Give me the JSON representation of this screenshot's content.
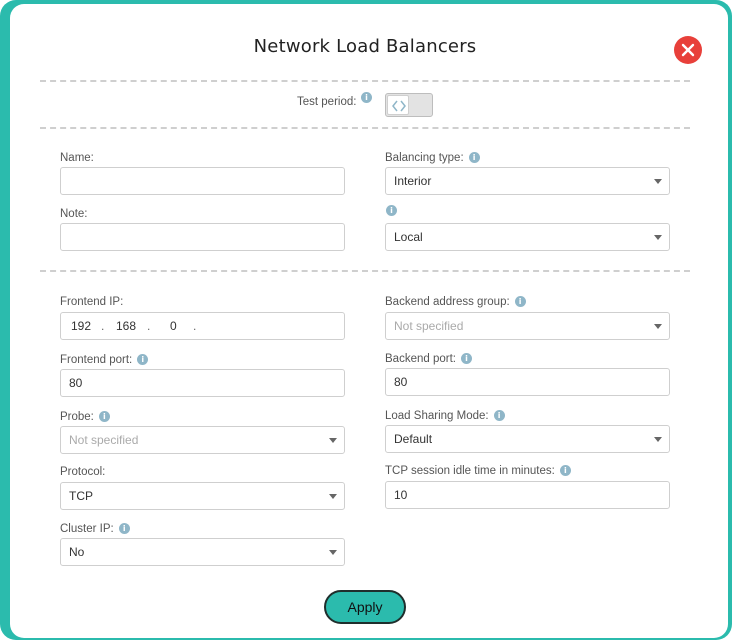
{
  "dialog": {
    "title": "Network Load Balancers",
    "test_period_label": "Test period:",
    "test_period_enabled": false
  },
  "form": {
    "name": {
      "label": "Name:",
      "value": ""
    },
    "note": {
      "label": "Note:",
      "value": ""
    },
    "balancing_type": {
      "label": "Balancing type:",
      "value": "Interior"
    },
    "scope": {
      "value": "Local"
    },
    "frontend_ip": {
      "label": "Frontend IP:",
      "octets": [
        "192",
        "168",
        "0",
        ""
      ],
      "dot": "."
    },
    "frontend_port": {
      "label": "Frontend port:",
      "value": "80"
    },
    "probe": {
      "label": "Probe:",
      "value": "Not specified"
    },
    "protocol": {
      "label": "Protocol:",
      "value": "TCP"
    },
    "cluster_ip": {
      "label": "Cluster IP:",
      "value": "No"
    },
    "backend_address_group": {
      "label": "Backend address group:",
      "value": "Not specified"
    },
    "backend_port": {
      "label": "Backend port:",
      "value": "80"
    },
    "load_sharing_mode": {
      "label": "Load Sharing Mode:",
      "value": "Default"
    },
    "tcp_idle_time": {
      "label": "TCP session idle time in minutes:",
      "value": "10"
    }
  },
  "actions": {
    "apply_label": "Apply"
  },
  "info_glyph": "i",
  "colors": {
    "accent": "#2bbbad",
    "close": "#e8403a",
    "info": "#8fb6c8"
  }
}
